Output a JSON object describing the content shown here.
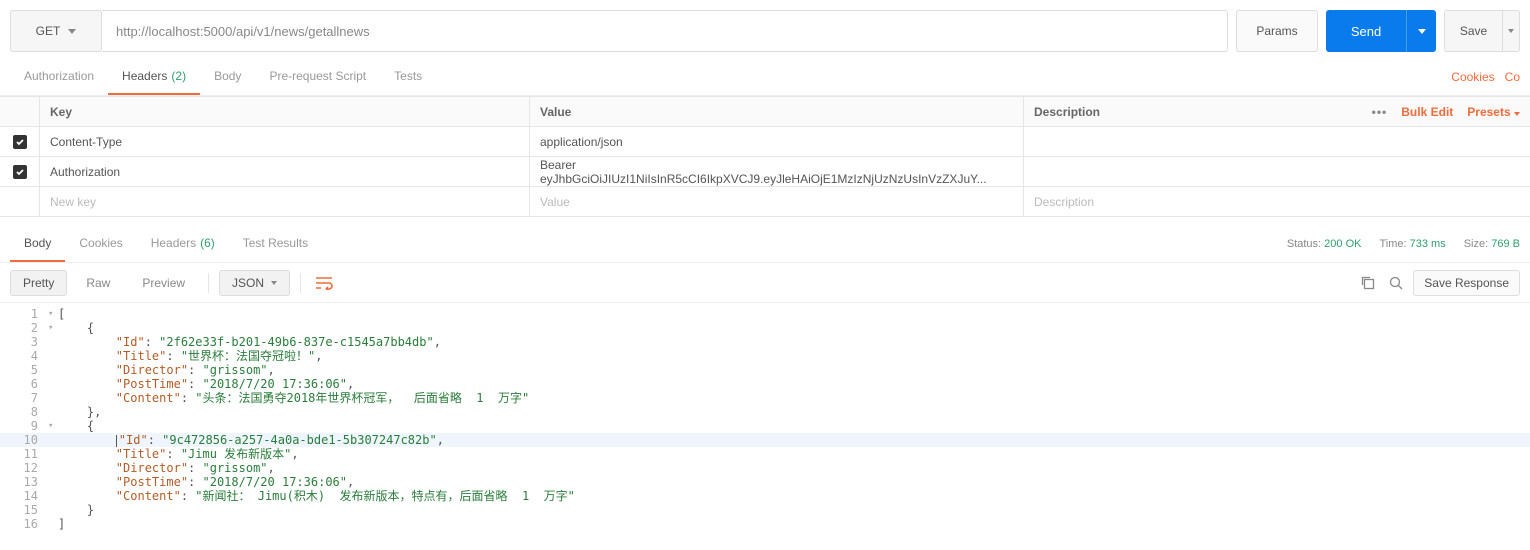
{
  "request": {
    "method": "GET",
    "url": "http://localhost:5000/api/v1/news/getallnews",
    "params_label": "Params",
    "send_label": "Send",
    "save_label": "Save"
  },
  "req_tabs": {
    "authorization": "Authorization",
    "headers": "Headers",
    "headers_count": "(2)",
    "body": "Body",
    "prerequest": "Pre-request Script",
    "tests": "Tests",
    "cookies": "Cookies",
    "code": "Co"
  },
  "headers_table": {
    "cols": {
      "key": "Key",
      "value": "Value",
      "description": "Description"
    },
    "bulk_edit": "Bulk Edit",
    "presets": "Presets",
    "rows": [
      {
        "checked": true,
        "key": "Content-Type",
        "value": "application/json",
        "description": ""
      },
      {
        "checked": true,
        "key": "Authorization",
        "value": "Bearer  eyJhbGciOiJIUzI1NiIsInR5cCI6IkpXVCJ9.eyJleHAiOjE1MzIzNjUzNzUsInVzZXJuY...",
        "description": ""
      }
    ],
    "new_row": {
      "key": "New key",
      "value": "Value",
      "description": "Description"
    }
  },
  "response": {
    "tabs": {
      "body": "Body",
      "cookies": "Cookies",
      "headers": "Headers",
      "headers_count": "(6)",
      "test_results": "Test Results"
    },
    "status_label": "Status:",
    "status_value": "200 OK",
    "time_label": "Time:",
    "time_value": "733 ms",
    "size_label": "Size:",
    "size_value": "769 B"
  },
  "body_toolbar": {
    "pretty": "Pretty",
    "raw": "Raw",
    "preview": "Preview",
    "format": "JSON",
    "save_response": "Save Response"
  },
  "code_lines": [
    {
      "n": 1,
      "fold": "▾",
      "indent": 0,
      "tokens": [
        [
          "pun",
          "["
        ]
      ]
    },
    {
      "n": 2,
      "fold": "▾",
      "indent": 1,
      "tokens": [
        [
          "pun",
          "{"
        ]
      ]
    },
    {
      "n": 3,
      "fold": "",
      "indent": 2,
      "tokens": [
        [
          "key",
          "\"Id\""
        ],
        [
          "pun",
          ": "
        ],
        [
          "str",
          "\"2f62e33f-b201-49b6-837e-c1545a7bb4db\""
        ],
        [
          "pun",
          ","
        ]
      ]
    },
    {
      "n": 4,
      "fold": "",
      "indent": 2,
      "tokens": [
        [
          "key",
          "\"Title\""
        ],
        [
          "pun",
          ": "
        ],
        [
          "str",
          "\"世界杯：法国夺冠啦！\""
        ],
        [
          "pun",
          ","
        ]
      ]
    },
    {
      "n": 5,
      "fold": "",
      "indent": 2,
      "tokens": [
        [
          "key",
          "\"Director\""
        ],
        [
          "pun",
          ": "
        ],
        [
          "str",
          "\"grissom\""
        ],
        [
          "pun",
          ","
        ]
      ]
    },
    {
      "n": 6,
      "fold": "",
      "indent": 2,
      "tokens": [
        [
          "key",
          "\"PostTime\""
        ],
        [
          "pun",
          ": "
        ],
        [
          "str",
          "\"2018/7/20 17:36:06\""
        ],
        [
          "pun",
          ","
        ]
      ]
    },
    {
      "n": 7,
      "fold": "",
      "indent": 2,
      "tokens": [
        [
          "key",
          "\"Content\""
        ],
        [
          "pun",
          ": "
        ],
        [
          "str",
          "\"头条：法国勇夺2018年世界杯冠军，  后面省略  1  万字\""
        ]
      ]
    },
    {
      "n": 8,
      "fold": "",
      "indent": 1,
      "tokens": [
        [
          "pun",
          "},"
        ]
      ]
    },
    {
      "n": 9,
      "fold": "▾",
      "indent": 1,
      "tokens": [
        [
          "pun",
          "{"
        ]
      ]
    },
    {
      "n": 10,
      "fold": "",
      "indent": 2,
      "highlight": true,
      "cursor": true,
      "tokens": [
        [
          "key",
          "\"Id\""
        ],
        [
          "pun",
          ": "
        ],
        [
          "str",
          "\"9c472856-a257-4a0a-bde1-5b307247c82b\""
        ],
        [
          "pun",
          ","
        ]
      ]
    },
    {
      "n": 11,
      "fold": "",
      "indent": 2,
      "tokens": [
        [
          "key",
          "\"Title\""
        ],
        [
          "pun",
          ": "
        ],
        [
          "str",
          "\"Jimu 发布新版本\""
        ],
        [
          "pun",
          ","
        ]
      ]
    },
    {
      "n": 12,
      "fold": "",
      "indent": 2,
      "tokens": [
        [
          "key",
          "\"Director\""
        ],
        [
          "pun",
          ": "
        ],
        [
          "str",
          "\"grissom\""
        ],
        [
          "pun",
          ","
        ]
      ]
    },
    {
      "n": 13,
      "fold": "",
      "indent": 2,
      "tokens": [
        [
          "key",
          "\"PostTime\""
        ],
        [
          "pun",
          ": "
        ],
        [
          "str",
          "\"2018/7/20 17:36:06\""
        ],
        [
          "pun",
          ","
        ]
      ]
    },
    {
      "n": 14,
      "fold": "",
      "indent": 2,
      "tokens": [
        [
          "key",
          "\"Content\""
        ],
        [
          "pun",
          ": "
        ],
        [
          "str",
          "\"新闻社： Jimu(积木)  发布新版本，特点有，后面省略  1  万字\""
        ]
      ]
    },
    {
      "n": 15,
      "fold": "",
      "indent": 1,
      "tokens": [
        [
          "pun",
          "}"
        ]
      ]
    },
    {
      "n": 16,
      "fold": "",
      "indent": 0,
      "tokens": [
        [
          "pun",
          "]"
        ]
      ]
    }
  ]
}
